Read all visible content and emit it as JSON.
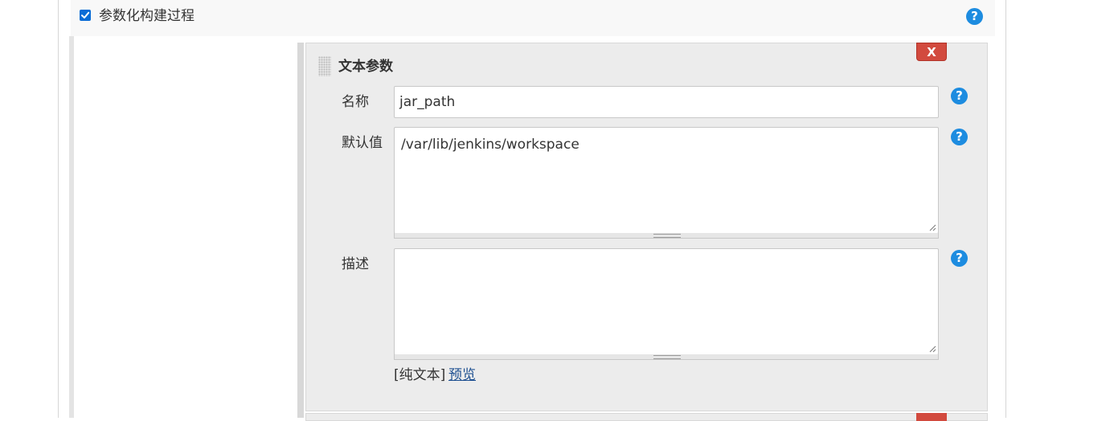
{
  "section": {
    "checkbox_label": "参数化构建过程",
    "checked": true
  },
  "param_card": {
    "title": "文本参数",
    "delete_label": "X",
    "fields": {
      "name": {
        "label": "名称",
        "value": "jar_path"
      },
      "default": {
        "label": "默认值",
        "value": "/var/lib/jenkins/workspace"
      },
      "description": {
        "label": "描述",
        "value": ""
      }
    },
    "format_mode": "[纯文本]",
    "preview_link": "预览"
  },
  "help_icon_text": "?"
}
